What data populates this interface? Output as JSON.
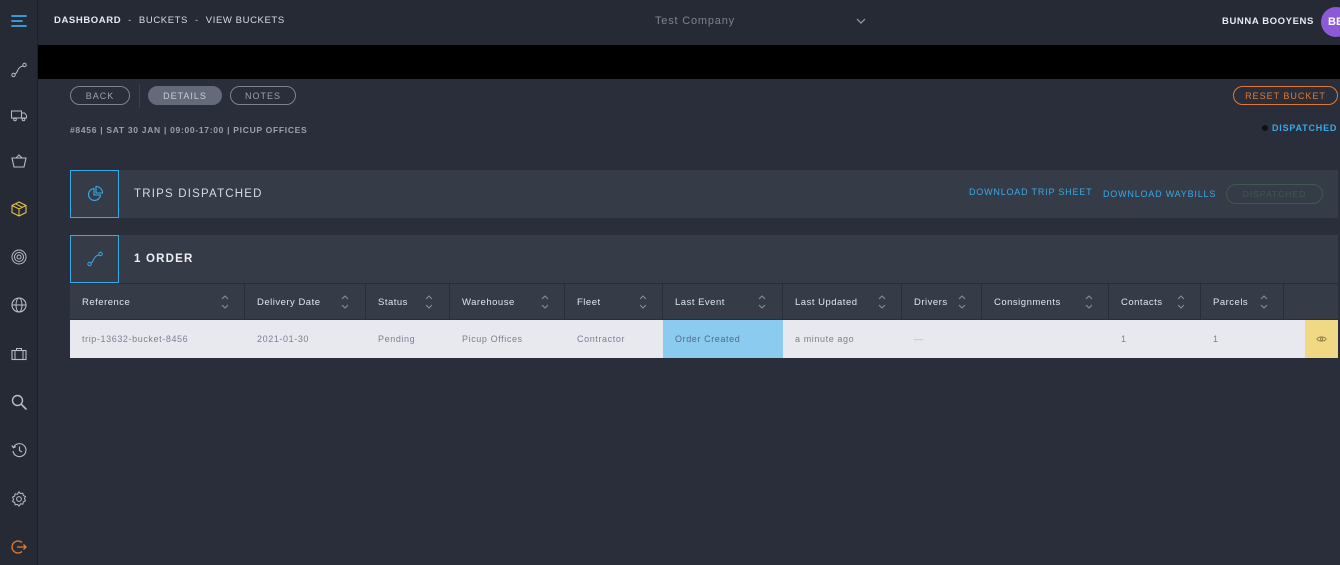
{
  "header": {
    "breadcrumb": {
      "item1": "DASHBOARD",
      "sep1": "-",
      "item2": "BUCKETS",
      "sep2": "-",
      "item3": "VIEW BUCKETS"
    },
    "company": "Test Company",
    "user_name": "BUNNA BOOYENS",
    "avatar_initials": "BB"
  },
  "sidebar": {
    "icons": [
      "menu-icon",
      "route-icon",
      "truck-icon",
      "basket-icon",
      "box-icon",
      "fingerprint-icon",
      "globe-icon",
      "briefcase-icon",
      "search-icon",
      "history-icon",
      "settings-icon",
      "logout-icon"
    ]
  },
  "actions": {
    "back": "BACK",
    "details": "DETAILS",
    "notes": "NOTES",
    "reset": "RESET BUCKET"
  },
  "meta": "#8456 | SAT 30 JAN | 09:00-17:00 | PICUP OFFICES",
  "status": "DISPATCHED",
  "trips_panel": {
    "title": "TRIPS DISPATCHED",
    "download_trip_sheet": "DOWNLOAD TRIP SHEET",
    "download_waybills": "DOWNLOAD WAYBILLS",
    "dispatched_button": "DISPATCHED"
  },
  "orders_panel": {
    "title": "1 ORDER"
  },
  "table": {
    "columns": [
      "Reference",
      "Delivery Date",
      "Status",
      "Warehouse",
      "Fleet",
      "Last Event",
      "Last Updated",
      "Drivers",
      "Consignments",
      "Contacts",
      "Parcels"
    ],
    "rows": [
      {
        "reference": "trip-13632-bucket-8456",
        "delivery_date": "2021-01-30",
        "status": "Pending",
        "warehouse": "Picup Offices",
        "fleet": "Contractor",
        "last_event": "Order Created",
        "last_updated": "a minute ago",
        "drivers": "—",
        "consignments": "",
        "contacts": "1",
        "parcels": "1"
      }
    ]
  },
  "colors": {
    "accent_blue": "#3aa9e6",
    "accent_orange": "#e07a33",
    "event_cell": "#8ccbf0",
    "action_cell": "#f0d884",
    "avatar": "#8c5ad6"
  }
}
